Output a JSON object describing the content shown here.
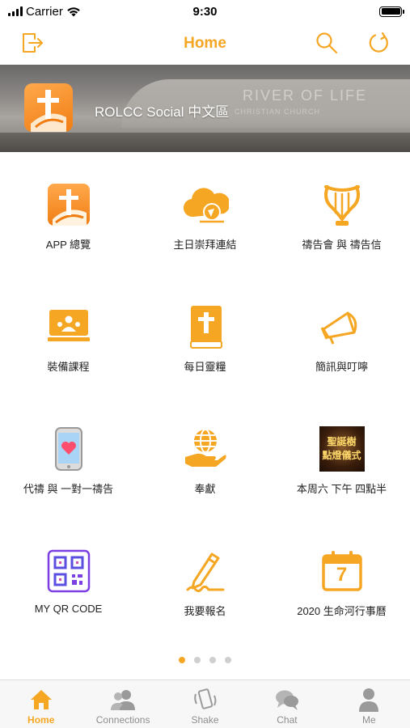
{
  "status_bar": {
    "carrier": "Carrier",
    "time": "9:30"
  },
  "nav": {
    "title": "Home"
  },
  "banner": {
    "name": "ROLCC Social  中文區",
    "sign_text": "RIVER OF LIFE",
    "sign_sub": "CHRISTIAN CHURCH"
  },
  "grid": {
    "items": [
      {
        "label": "APP 總覽",
        "icon": "app-logo-icon"
      },
      {
        "label": "主日崇拜連結",
        "icon": "cloud-worship-icon"
      },
      {
        "label": "禱告會 與 禱告信",
        "icon": "lyre-icon"
      },
      {
        "label": "裝備課程",
        "icon": "classroom-icon"
      },
      {
        "label": "每日靈糧",
        "icon": "bible-icon"
      },
      {
        "label": "簡訊與叮嚀",
        "icon": "megaphone-icon"
      },
      {
        "label": "代禱 與 一對一禱告",
        "icon": "phone-heart-icon"
      },
      {
        "label": "奉獻",
        "icon": "hand-globe-icon"
      },
      {
        "label": "本周六 下午 四點半",
        "icon": "event-image-icon",
        "image_text_line1": "聖誕樹",
        "image_text_line2": "點燈儀式"
      },
      {
        "label": "MY QR CODE",
        "icon": "qr-code-icon"
      },
      {
        "label": "我要報名",
        "icon": "pen-signature-icon"
      },
      {
        "label": "2020 生命河行事曆",
        "icon": "calendar-icon",
        "calendar_day": "7"
      }
    ]
  },
  "pager": {
    "pages": 4,
    "active": 0
  },
  "tabs": [
    {
      "label": "Home",
      "icon": "home-icon",
      "active": true
    },
    {
      "label": "Connections",
      "icon": "connections-icon",
      "active": false
    },
    {
      "label": "Shake",
      "icon": "shake-icon",
      "active": false
    },
    {
      "label": "Chat",
      "icon": "chat-icon",
      "active": false
    },
    {
      "label": "Me",
      "icon": "person-icon",
      "active": false
    }
  ],
  "colors": {
    "accent": "#f5a623",
    "tab_inactive": "#8e8e8e",
    "qr_purple": "#7b3fe4"
  }
}
